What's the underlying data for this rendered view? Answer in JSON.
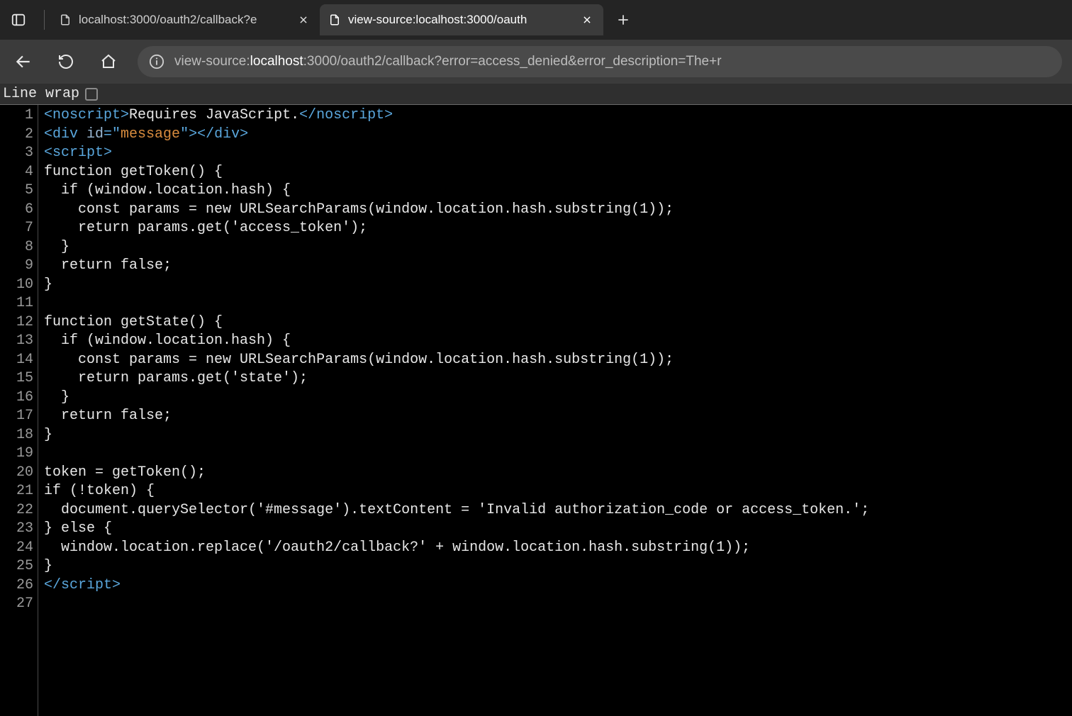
{
  "tabs": {
    "inactive_title": "localhost:3000/oauth2/callback?e",
    "active_title": "view-source:localhost:3000/oauth"
  },
  "address": {
    "prefix": "view-source:",
    "host": "localhost",
    "rest": ":3000/oauth2/callback?error=access_denied&error_description=The+r"
  },
  "wrap": {
    "label": "Line wrap"
  },
  "source": {
    "line_count": 27,
    "lines": [
      [
        {
          "c": "tag",
          "t": "<noscript>"
        },
        {
          "c": "text",
          "t": "Requires JavaScript."
        },
        {
          "c": "tag",
          "t": "</noscript>"
        }
      ],
      [
        {
          "c": "tag",
          "t": "<div "
        },
        {
          "c": "attr",
          "t": "id"
        },
        {
          "c": "tag",
          "t": "=\""
        },
        {
          "c": "str",
          "t": "message"
        },
        {
          "c": "tag",
          "t": "\"></div>"
        }
      ],
      [
        {
          "c": "tag",
          "t": "<script>"
        }
      ],
      [
        {
          "c": "text",
          "t": "function getToken() {"
        }
      ],
      [
        {
          "c": "text",
          "t": "  if (window.location.hash) {"
        }
      ],
      [
        {
          "c": "text",
          "t": "    const params = new URLSearchParams(window.location.hash.substring(1));"
        }
      ],
      [
        {
          "c": "text",
          "t": "    return params.get('access_token');"
        }
      ],
      [
        {
          "c": "text",
          "t": "  }"
        }
      ],
      [
        {
          "c": "text",
          "t": "  return false;"
        }
      ],
      [
        {
          "c": "text",
          "t": "}"
        }
      ],
      [
        {
          "c": "text",
          "t": ""
        }
      ],
      [
        {
          "c": "text",
          "t": "function getState() {"
        }
      ],
      [
        {
          "c": "text",
          "t": "  if (window.location.hash) {"
        }
      ],
      [
        {
          "c": "text",
          "t": "    const params = new URLSearchParams(window.location.hash.substring(1));"
        }
      ],
      [
        {
          "c": "text",
          "t": "    return params.get('state');"
        }
      ],
      [
        {
          "c": "text",
          "t": "  }"
        }
      ],
      [
        {
          "c": "text",
          "t": "  return false;"
        }
      ],
      [
        {
          "c": "text",
          "t": "}"
        }
      ],
      [
        {
          "c": "text",
          "t": ""
        }
      ],
      [
        {
          "c": "text",
          "t": "token = getToken();"
        }
      ],
      [
        {
          "c": "text",
          "t": "if (!token) {"
        }
      ],
      [
        {
          "c": "text",
          "t": "  document.querySelector('#message').textContent = 'Invalid authorization_code or access_token.';"
        }
      ],
      [
        {
          "c": "text",
          "t": "} else {"
        }
      ],
      [
        {
          "c": "text",
          "t": "  window.location.replace('/oauth2/callback?' + window.location.hash.substring(1));"
        }
      ],
      [
        {
          "c": "text",
          "t": "}"
        }
      ],
      [
        {
          "c": "tag",
          "t": "</script>"
        }
      ],
      [
        {
          "c": "text",
          "t": ""
        }
      ]
    ]
  }
}
